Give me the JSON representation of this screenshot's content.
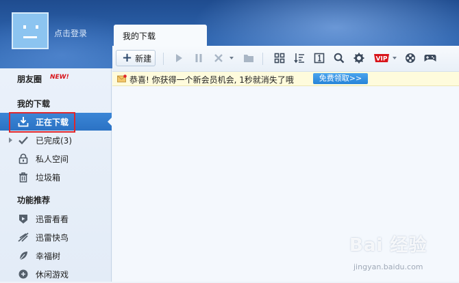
{
  "header": {
    "login_text": "点击登录"
  },
  "tab": {
    "label": "我的下载"
  },
  "toolbar": {
    "new_label": "新建"
  },
  "notice": {
    "message": "恭喜! 你获得一个新会员机会, 1秒就消失了哦",
    "claim_label": "免费领取>>"
  },
  "sidebar": {
    "friends_label": "朋友圈",
    "new_badge": "NEW!",
    "downloads_header": "我的下载",
    "items": [
      {
        "label": "正在下载",
        "icon": "download-icon"
      },
      {
        "label": "已完成(3)",
        "icon": "check-icon"
      },
      {
        "label": "私人空间",
        "icon": "lock-icon"
      },
      {
        "label": "垃圾箱",
        "icon": "trash-icon"
      }
    ],
    "features_header": "功能推荐",
    "features": [
      {
        "label": "迅雷看看",
        "icon": "kankan-icon"
      },
      {
        "label": "迅雷快鸟",
        "icon": "bird-icon"
      },
      {
        "label": "幸福树",
        "icon": "leaf-icon"
      },
      {
        "label": "休闲游戏",
        "icon": "game-icon"
      }
    ]
  },
  "watermark": {
    "text": "Bai 经验",
    "sub": "jingyan.baidu.com"
  },
  "colors": {
    "banner": "#2d63ad",
    "active": "#2b72c4",
    "highlight": "#e0262b",
    "vip": "#d8141a"
  }
}
